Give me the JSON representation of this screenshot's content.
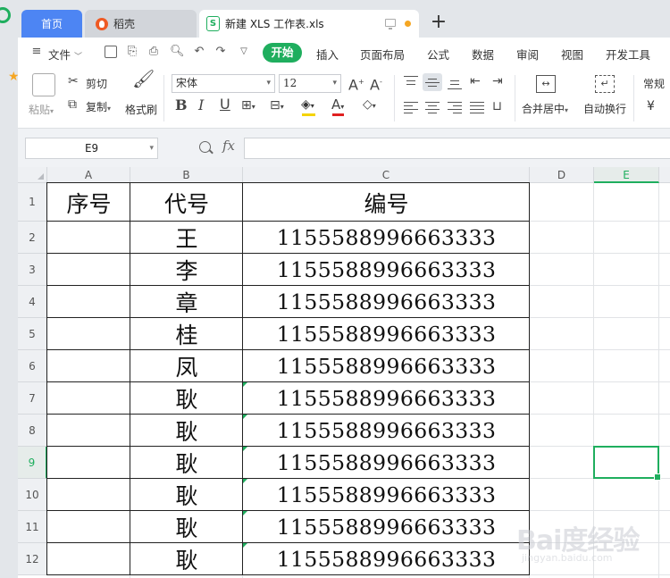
{
  "tabs": {
    "home": "首页",
    "docer": "稻壳",
    "file": "新建 XLS 工作表.xls",
    "new_tab": "+"
  },
  "menu": {
    "file": "文件",
    "start": "开始",
    "insert": "插入",
    "layout": "页面布局",
    "formula": "公式",
    "data": "数据",
    "review": "审阅",
    "view": "视图",
    "dev": "开发工具"
  },
  "tools": {
    "paste": "粘贴",
    "cut": "剪切",
    "copy": "复制",
    "format_painter": "格式刷",
    "font_name": "宋体",
    "font_size": "12",
    "bold": "B",
    "italic": "I",
    "underline": "U",
    "merge_center": "合并居中",
    "wrap_text": "自动换行",
    "number_format": "常规",
    "currency": "¥"
  },
  "formula_bar": {
    "cell_ref": "E9",
    "fx": "fx"
  },
  "sheet": {
    "columns": [
      "A",
      "B",
      "C",
      "D",
      "E"
    ],
    "rows": [
      "1",
      "2",
      "3",
      "4",
      "5",
      "6",
      "7",
      "8",
      "9",
      "10",
      "11",
      "12"
    ],
    "headers": [
      "序号",
      "代号",
      "编号"
    ],
    "names": [
      "王",
      "李",
      "章",
      "桂",
      "凤",
      "耿",
      "耿",
      "耿",
      "耿",
      "耿",
      "耿"
    ],
    "numbers": [
      "1155588996663333",
      "1155588996663333",
      "1155588996663333",
      "1155588996663333",
      "1155588996663333",
      "1155588996663333",
      "1155588996663333",
      "1155588996663333",
      "1155588996663333",
      "1155588996663333",
      "1155588996663333"
    ],
    "active_cell": "E9"
  },
  "watermark": {
    "text": "Bai度经验",
    "url": "jingyan.baidu.com"
  },
  "colors": {
    "accent": "#1fae5e",
    "home_tab": "#4d85f3"
  }
}
